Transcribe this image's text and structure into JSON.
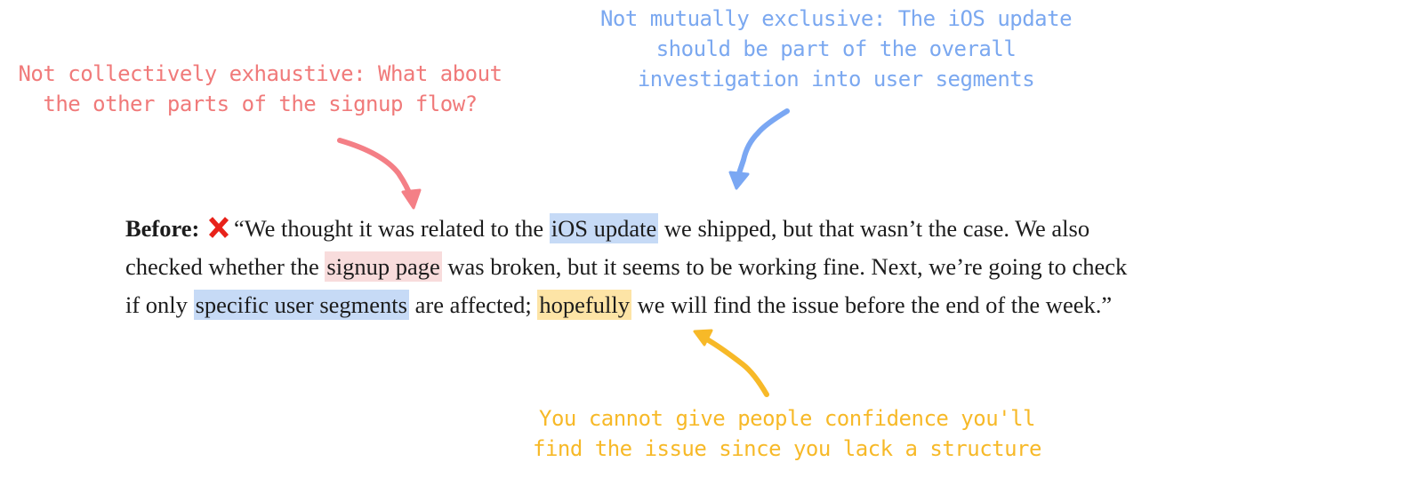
{
  "annotations": {
    "collectively": {
      "lines": [
        "Not collectively exhaustive: What about",
        "the other parts of the signup flow?"
      ],
      "color": "#f07a7a"
    },
    "mutually": {
      "lines": [
        "Not mutually exclusive: The iOS update",
        "should be part of the overall",
        "investigation into user segments"
      ],
      "color": "#7ba8f0"
    },
    "confidence": {
      "lines": [
        "You cannot give people confidence you'll",
        "find the issue since you lack a structure"
      ],
      "color": "#f7b928"
    }
  },
  "quote": {
    "label": "Before:",
    "status_icon": "red-cross-icon",
    "line1": {
      "pre": "“We thought it was related to the ",
      "highlight": "iOS update",
      "post": " we shipped, but that wasn’t the case. We also"
    },
    "line2": {
      "pre": "checked whether the ",
      "highlight": "signup page",
      "post": " was broken, but it seems to be working fine. Next, we’re going to check"
    },
    "line3": {
      "pre": "if only ",
      "highlight1": "specific user segments",
      "mid": " are affected; ",
      "highlight2": "hopefully",
      "post": " we will find the issue before the end of the week.”"
    }
  }
}
